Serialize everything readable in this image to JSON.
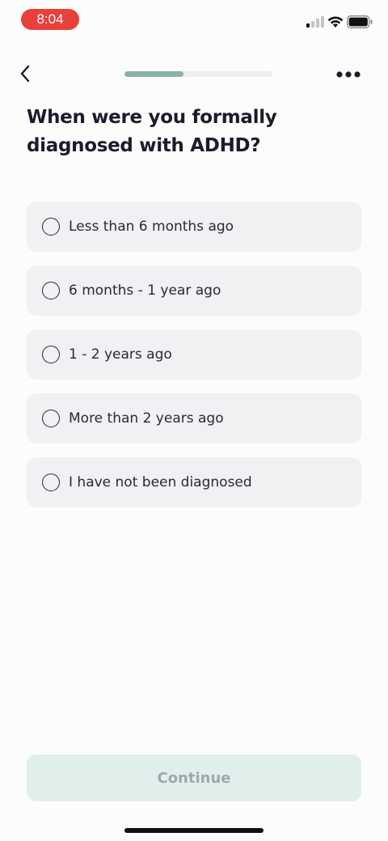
{
  "status_bar": {
    "time": "8:04",
    "time_badge_color": "#e8403a",
    "icons": [
      "signal-icon",
      "wifi-icon",
      "battery-icon"
    ]
  },
  "nav": {
    "back_icon": "chevron-left-icon",
    "more_icon": "more-horizontal-icon",
    "progress_fraction": 0.4,
    "progress_color": "#89b1aa"
  },
  "question": {
    "title": "When were you formally diagnosed with ADHD?"
  },
  "options": [
    {
      "label": "Less than 6 months ago",
      "selected": false
    },
    {
      "label": "6 months - 1 year ago",
      "selected": false
    },
    {
      "label": "1 - 2 years ago",
      "selected": false
    },
    {
      "label": "More than 2 years ago",
      "selected": false
    },
    {
      "label": "I have not been diagnosed",
      "selected": false
    }
  ],
  "continue": {
    "label": "Continue",
    "enabled": false,
    "color": "#e0efec"
  }
}
